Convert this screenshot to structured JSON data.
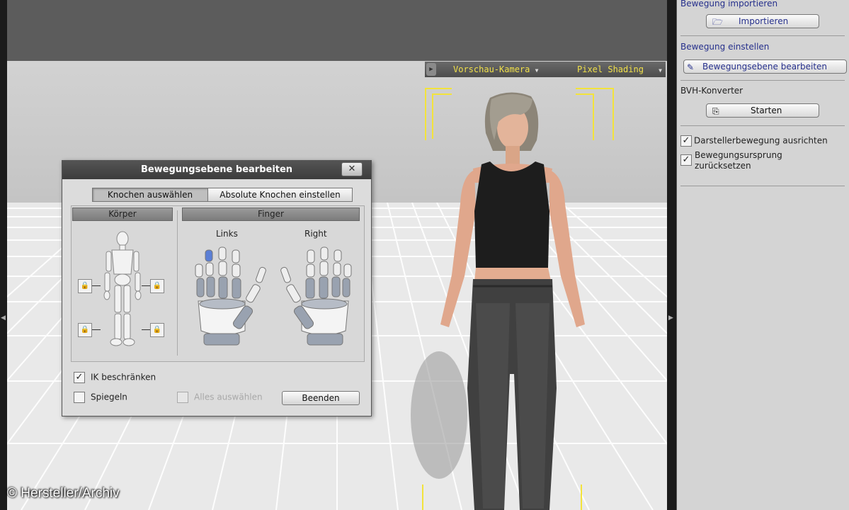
{
  "viewport": {
    "camera_label": "Vorschau-Kamera",
    "shading_label": "Pixel Shading"
  },
  "dialog": {
    "title": "Bewegungsebene bearbeiten",
    "close_symbol": "✕",
    "tabs": [
      {
        "label": "Knochen auswählen",
        "active": true
      },
      {
        "label": "Absolute Knochen einstellen",
        "active": false
      }
    ],
    "body_header": "Körper",
    "finger_header": "Finger",
    "left_hand_label": "Links",
    "right_hand_label": "Right",
    "options": {
      "ik_label": "IK beschränken",
      "ik_checked": true,
      "mirror_label": "Spiegeln",
      "mirror_checked": false,
      "select_all_label": "Alles auswählen",
      "select_all_enabled": false
    },
    "finish_label": "Beenden"
  },
  "sidebar": {
    "import_heading": "Bewegung importieren",
    "import_button": "Importieren",
    "adjust_heading": "Bewegung einstellen",
    "adjust_button": "Bewegungsebene bearbeiten",
    "bvh_heading": "BVH-Konverter",
    "bvh_button": "Starten",
    "options": [
      {
        "label": "Darstellerbewegung ausrichten",
        "checked": true
      },
      {
        "label_line1": "Bewegungsursprung",
        "label_line2": "zurücksetzen",
        "checked": true
      }
    ]
  },
  "watermark": "© Hersteller/Archiv",
  "colors": {
    "accent_yellow": "#f3e33b",
    "sidebar_heading": "#26308c",
    "selected_finger": "#5b7fd6"
  }
}
